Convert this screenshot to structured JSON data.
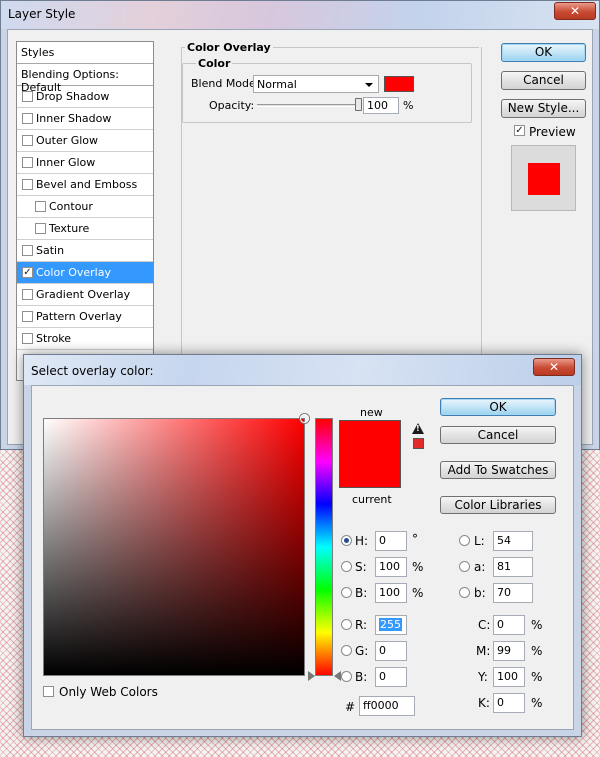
{
  "layer_style": {
    "title": "Layer Style",
    "close": "✕",
    "styles_header": "Styles",
    "blending_options": "Blending Options: Default",
    "items": [
      {
        "label": "Drop Shadow",
        "checked": false,
        "indent": false,
        "selected": false
      },
      {
        "label": "Inner Shadow",
        "checked": false,
        "indent": false,
        "selected": false
      },
      {
        "label": "Outer Glow",
        "checked": false,
        "indent": false,
        "selected": false
      },
      {
        "label": "Inner Glow",
        "checked": false,
        "indent": false,
        "selected": false
      },
      {
        "label": "Bevel and Emboss",
        "checked": false,
        "indent": false,
        "selected": false
      },
      {
        "label": "Contour",
        "checked": false,
        "indent": true,
        "selected": false
      },
      {
        "label": "Texture",
        "checked": false,
        "indent": true,
        "selected": false
      },
      {
        "label": "Satin",
        "checked": false,
        "indent": false,
        "selected": false
      },
      {
        "label": "Color Overlay",
        "checked": true,
        "indent": false,
        "selected": true
      },
      {
        "label": "Gradient Overlay",
        "checked": false,
        "indent": false,
        "selected": false
      },
      {
        "label": "Pattern Overlay",
        "checked": false,
        "indent": false,
        "selected": false
      },
      {
        "label": "Stroke",
        "checked": false,
        "indent": false,
        "selected": false
      }
    ],
    "color_overlay_group": "Color Overlay",
    "color_group": "Color",
    "blend_mode_label": "Blend Mode:",
    "blend_mode_value": "Normal",
    "overlay_color": "#ff0000",
    "opacity_label": "Opacity:",
    "opacity_value": "100",
    "opacity_unit": "%",
    "opacity_fraction": 1.0,
    "ok": "OK",
    "cancel": "Cancel",
    "new_style": "New Style...",
    "preview_label": "Preview",
    "preview_checked": true,
    "preview_color": "#ff0000"
  },
  "picker": {
    "title": "Select overlay color:",
    "close": "✕",
    "new_label": "new",
    "current_label": "current",
    "new_color": "#ff0000",
    "current_color": "#ff0000",
    "hue_marker_fraction": 1.0,
    "ok": "OK",
    "cancel": "Cancel",
    "add_to_swatches": "Add To Swatches",
    "color_libraries": "Color Libraries",
    "only_web_colors": "Only Web Colors",
    "only_web_checked": false,
    "fields": {
      "H": {
        "label": "H:",
        "value": "0",
        "unit": "°",
        "selected": true
      },
      "S": {
        "label": "S:",
        "value": "100",
        "unit": "%",
        "selected": false
      },
      "B": {
        "label": "B:",
        "value": "100",
        "unit": "%",
        "selected": false
      },
      "R": {
        "label": "R:",
        "value": "255",
        "unit": "",
        "selected": false
      },
      "G": {
        "label": "G:",
        "value": "0",
        "unit": "",
        "selected": false
      },
      "Bl": {
        "label": "B:",
        "value": "0",
        "unit": "",
        "selected": false
      },
      "L": {
        "label": "L:",
        "value": "54",
        "selected": false
      },
      "a": {
        "label": "a:",
        "value": "81",
        "selected": false
      },
      "b": {
        "label": "b:",
        "value": "70",
        "selected": false
      },
      "C": {
        "label": "C:",
        "value": "0",
        "unit": "%"
      },
      "M": {
        "label": "M:",
        "value": "99",
        "unit": "%"
      },
      "Y": {
        "label": "Y:",
        "value": "100",
        "unit": "%"
      },
      "K": {
        "label": "K:",
        "value": "0",
        "unit": "%"
      }
    },
    "hex_label": "#",
    "hex_value": "ff0000"
  }
}
